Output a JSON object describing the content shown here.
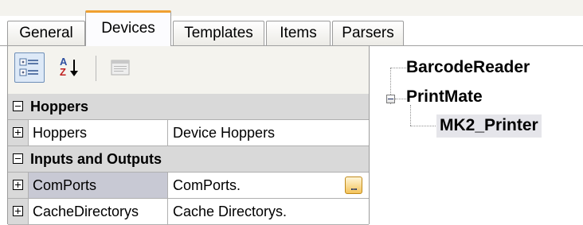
{
  "tabs": [
    {
      "label": "General",
      "active": false
    },
    {
      "label": "Devices",
      "active": true
    },
    {
      "label": "Templates",
      "active": false
    },
    {
      "label": "Items",
      "active": false
    },
    {
      "label": "Parsers",
      "active": false
    }
  ],
  "toolbar": {
    "buttons": [
      {
        "icon": "categorized-icon",
        "pressed": true
      },
      {
        "icon": "alphabetical-sort-icon",
        "pressed": false
      },
      {
        "icon": "property-pages-icon",
        "pressed": false
      }
    ],
    "az_glyph": "A Z"
  },
  "property_grid": {
    "categories": [
      {
        "label": "Hoppers",
        "expanded": true,
        "rows": [
          {
            "name": "Hoppers",
            "value": "Device Hoppers",
            "selected": false,
            "expandable": true
          }
        ]
      },
      {
        "label": "Inputs and Outputs",
        "expanded": true,
        "rows": [
          {
            "name": "ComPorts",
            "value": "ComPorts.",
            "selected": true,
            "expandable": true,
            "has_ellipsis": true
          },
          {
            "name": "CacheDirectorys",
            "value": "Cache Directorys.",
            "selected": false,
            "expandable": true
          }
        ]
      }
    ],
    "ellipsis_label": "..."
  },
  "tree": {
    "nodes": [
      {
        "label": "BarcodeReader",
        "level": 0
      },
      {
        "label": "PrintMate",
        "level": 0,
        "expanded": true
      },
      {
        "label": "MK2_Printer",
        "level": 1,
        "selected": true
      }
    ]
  },
  "colors": {
    "active_tab_accent": "#f0a030",
    "selection": "#c8c9d4",
    "category_bg": "#d9d9d9"
  }
}
